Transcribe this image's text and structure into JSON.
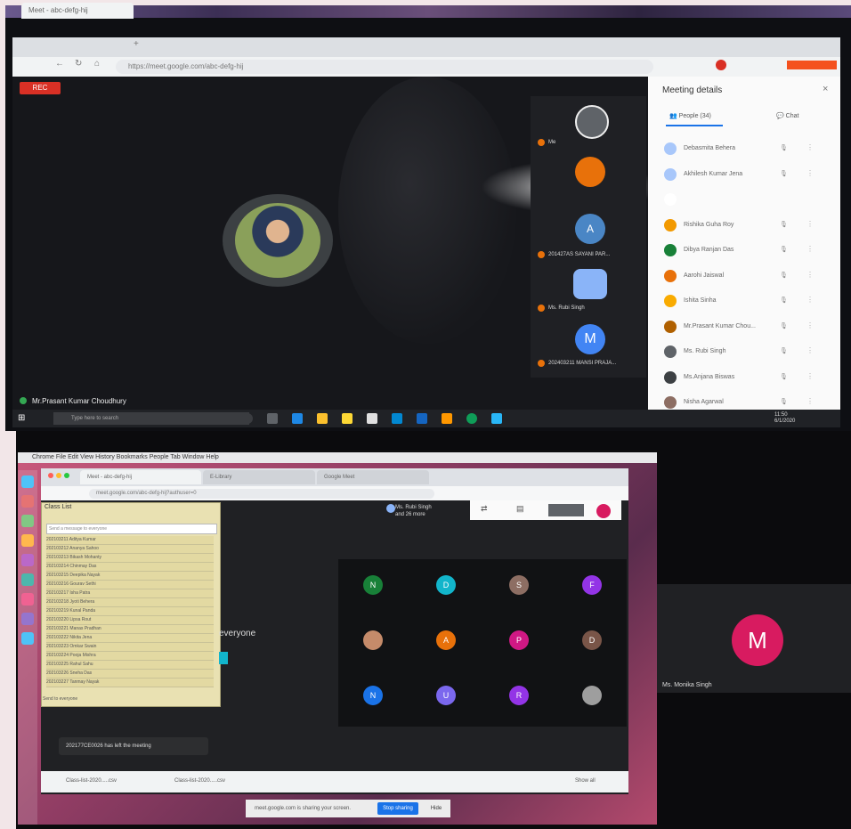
{
  "top": {
    "tab_title": "Meet - abc-defg-hij",
    "url": "https://meet.google.com/abc-defg-hij",
    "rec_label": "REC",
    "presenter_name": "Mr.Prasant Kumar Choudhury",
    "tiles": [
      {
        "initial": "",
        "label": "Me",
        "color": "#5f6368"
      },
      {
        "initial": "",
        "label": "",
        "color": "#e8710a"
      },
      {
        "initial": "A",
        "label": "201427AS SAYANI PAR...",
        "color": "#4a86c5"
      },
      {
        "initial": "",
        "label": "Ms. Rubi Singh",
        "color": "#8ab4f8"
      },
      {
        "initial": "M",
        "label": "202403211 MANSI PRAJA...",
        "color": "#4285f4"
      }
    ],
    "panel": {
      "title": "Meeting details",
      "tab_people": "People (34)",
      "tab_chat": "Chat",
      "participants": [
        {
          "name": "Debasmita Behera",
          "color": "#a8c7fa"
        },
        {
          "name": "Akhilesh Kumar Jena",
          "color": "#a8c7fa"
        },
        {
          "name": "",
          "color": "#ffffff"
        },
        {
          "name": "Rishika Guha Roy",
          "color": "#f29900"
        },
        {
          "name": "Dibya Ranjan Das",
          "color": "#188038"
        },
        {
          "name": "Aarohi Jaiswal",
          "color": "#e8710a"
        },
        {
          "name": "Ishita Sinha",
          "color": "#f9ab00"
        },
        {
          "name": "Mr.Prasant Kumar Chou...",
          "color": "#b06000"
        },
        {
          "name": "Ms. Rubi Singh",
          "color": "#5f6368"
        },
        {
          "name": "Ms.Anjana Biswas",
          "color": "#3c4043"
        },
        {
          "name": "Nisha Agarwal",
          "color": "#8d6e63"
        }
      ]
    },
    "taskbar": {
      "search_placeholder": "Type here to search",
      "time": "11:50\n6/1/2020"
    }
  },
  "bottom": {
    "mac_menu": "Chrome  File  Edit  View  History  Bookmarks  People  Tab  Window  Help",
    "tab_title": "Meet - abc-defg-hij",
    "tab2": "E-Library",
    "tab3": "Google Meet",
    "url": "meet.google.com/abc-defg-hij?authuser=0",
    "chat_title": "Class List",
    "chat_input_placeholder": "Send a message to everyone",
    "chat_lines": [
      "202103211 Aditya Kumar",
      "202103212 Ananya Sahoo",
      "202103213 Bikash Mohanty",
      "202103214 Chinmay Das",
      "202103215 Deepika Nayak",
      "202103216 Gourav Sethi",
      "202103217 Isha Patra",
      "202103218 Jyoti Behera",
      "202103219 Kunal Panda",
      "202103220 Lipsa Rout",
      "202103221 Manas Pradhan",
      "202103222 Nikita Jena",
      "202103223 Omkar Swain",
      "202103224 Pooja Mishra",
      "202103225 Rahul Sahu",
      "202103226 Sneha Das",
      "202103227 Tanmay Nayak"
    ],
    "chat_footer": "Send to everyone",
    "top_name": "Ms. Rubi Singh\nand 26 more",
    "everyone_text": "everyone",
    "grid": [
      {
        "initial": "N",
        "color": "#188038"
      },
      {
        "initial": "D",
        "color": "#12b5cb"
      },
      {
        "initial": "S",
        "color": "#8d6e63"
      },
      {
        "initial": "F",
        "color": "#9334e6"
      },
      {
        "initial": "",
        "color": "#c58b6a"
      },
      {
        "initial": "A",
        "color": "#e8710a"
      },
      {
        "initial": "P",
        "color": "#d01884"
      },
      {
        "initial": "D",
        "color": "#795548"
      },
      {
        "initial": "N",
        "color": "#1a73e8"
      },
      {
        "initial": "U",
        "color": "#7b68ee"
      },
      {
        "initial": "R",
        "color": "#9334e6"
      },
      {
        "initial": "",
        "color": "#9e9e9e"
      }
    ],
    "join_toast": "202177CE0026 has left the meeting",
    "downloads": [
      "Class-list-2020.....csv",
      "Class-list-2020.....csv",
      "Show all"
    ],
    "share_text": "meet.google.com is sharing your screen.",
    "share_button": "Stop sharing",
    "hide_button": "Hide",
    "side_avatar_initial": "M",
    "side_name": "Ms. Monika Singh"
  }
}
